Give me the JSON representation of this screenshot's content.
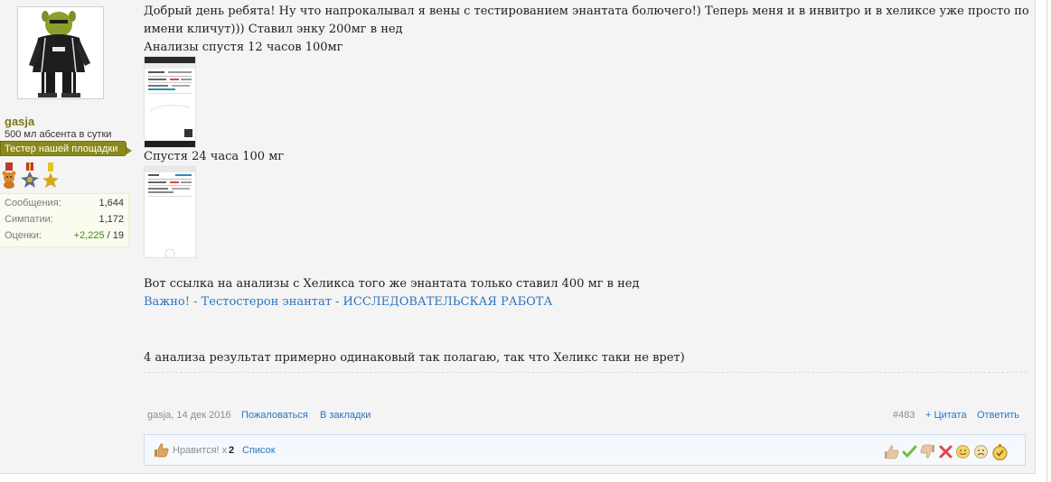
{
  "user": {
    "name": "gasja",
    "title": "500 мл абсента в сутки",
    "banner": "Тестер нашей площадки",
    "stats": [
      {
        "label": "Сообщения:",
        "value": "1,644"
      },
      {
        "label": "Симпатии:",
        "value": "1,172"
      },
      {
        "label": "Оценки:",
        "value_positive": "+2,225",
        "value_rest": " / 19"
      }
    ]
  },
  "message": {
    "paragraph1": "Добрый день ребята! Ну что напрокалывал я вены с тестированием энантата болючего!) Теперь меня и в инвитро и в хеликсе уже просто по имени кличут))) Ставил энку 200мг в нед",
    "caption1": "Анализы спустя 12 часов 100мг",
    "caption2": "Спустя 24 часа 100 мг",
    "link_intro": "Вот ссылка на анализы с Хеликса того же энантата только ставил 400 мг в нед",
    "link_text": "Важно! - Тестостерон энантат - ИССЛЕДОВАТЕЛЬСКАЯ РАБОТА",
    "conclusion": "4 анализа результат примерно одинаковый так полагаю, так что Хеликс таки не врет)"
  },
  "meta": {
    "author_date": "gasja, 14 дек 2016",
    "report": "Пожаловаться",
    "bookmark": "В закладки",
    "post_number": "#483",
    "quote": "+ Цитата",
    "reply": "Ответить"
  },
  "likes": {
    "text": "Нравится! x",
    "count": "2",
    "list": "Список"
  },
  "colors": {
    "link": "#2b73c2",
    "banner": "#8a8a1c",
    "username": "#7a7a12",
    "positive": "#3c8d10"
  }
}
